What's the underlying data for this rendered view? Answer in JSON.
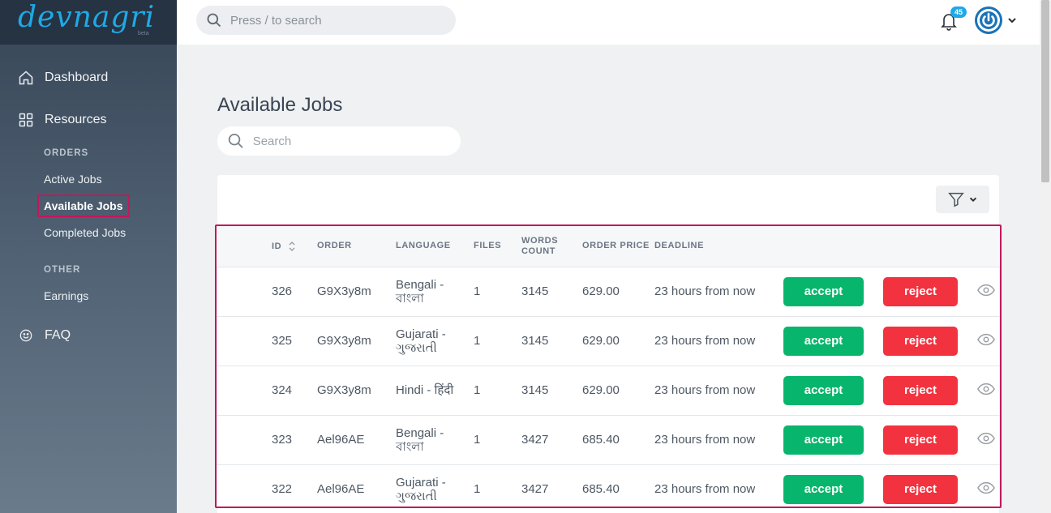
{
  "brand": {
    "logo_text": "devnagri",
    "logo_sub": "beta",
    "accent": "#1fa9e6",
    "highlight": "#c2185b"
  },
  "topbar": {
    "search_placeholder": "Press / to search",
    "notification_count": "45"
  },
  "sidebar": {
    "dashboard": "Dashboard",
    "resources": "Resources",
    "orders_title": "ORDERS",
    "active_jobs": "Active Jobs",
    "available_jobs": "Available Jobs",
    "completed_jobs": "Completed Jobs",
    "other_title": "OTHER",
    "earnings": "Earnings",
    "faq": "FAQ"
  },
  "main": {
    "title": "Available Jobs",
    "search_placeholder": "Search",
    "columns": {
      "id": "ID",
      "order": "ORDER",
      "language": "LANGUAGE",
      "files": "FILES",
      "words_count": "WORDS COUNT",
      "order_price": "ORDER PRICE",
      "deadline": "DEADLINE"
    },
    "accept_label": "accept",
    "reject_label": "reject",
    "rows": [
      {
        "id": "326",
        "order": "G9X3y8m",
        "language": "Bengali - বাংলা",
        "files": "1",
        "words": "3145",
        "price": "629.00",
        "deadline": "23 hours from now"
      },
      {
        "id": "325",
        "order": "G9X3y8m",
        "language": "Gujarati - ગુજરાતી",
        "files": "1",
        "words": "3145",
        "price": "629.00",
        "deadline": "23 hours from now"
      },
      {
        "id": "324",
        "order": "G9X3y8m",
        "language": "Hindi - हिंदी",
        "files": "1",
        "words": "3145",
        "price": "629.00",
        "deadline": "23 hours from now"
      },
      {
        "id": "323",
        "order": "Ael96AE",
        "language": "Bengali - বাংলা",
        "files": "1",
        "words": "3427",
        "price": "685.40",
        "deadline": "23 hours from now"
      },
      {
        "id": "322",
        "order": "Ael96AE",
        "language": "Gujarati - ગુજરાતી",
        "files": "1",
        "words": "3427",
        "price": "685.40",
        "deadline": "23 hours from now"
      }
    ]
  }
}
